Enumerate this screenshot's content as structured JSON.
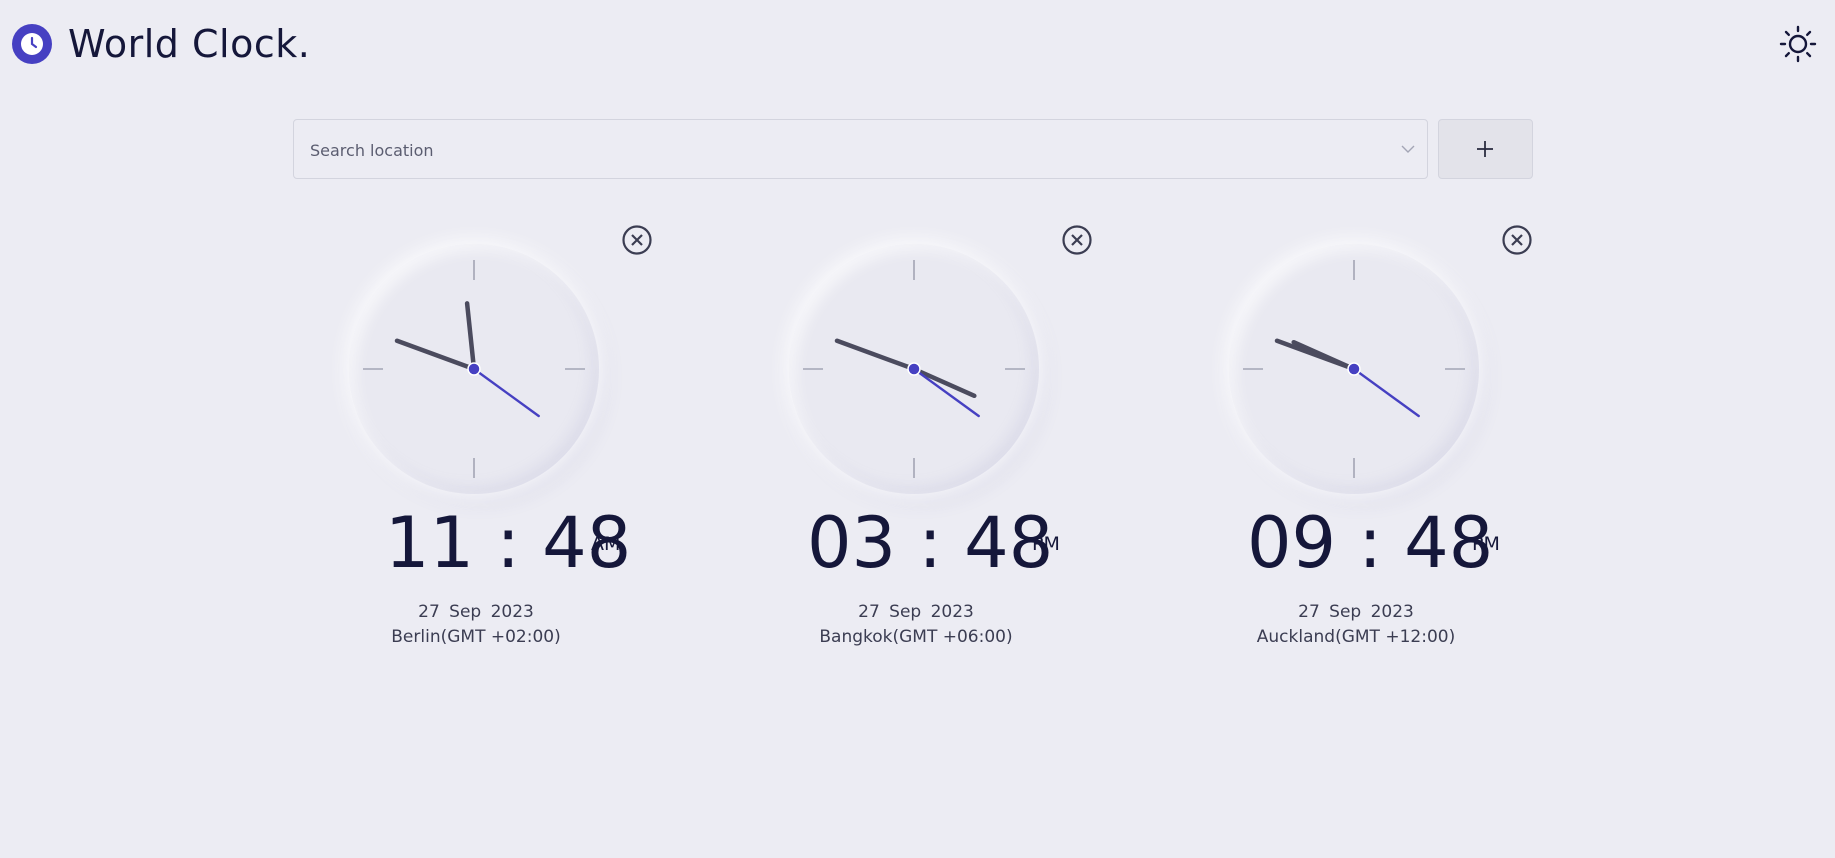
{
  "app": {
    "title": "World Clock.",
    "logo_icon": "clock-icon",
    "theme_icon": "sun-icon"
  },
  "colors": {
    "background": "#ececf3",
    "accent": "#4640c2",
    "text": "#15173a",
    "hand": "#4b4b5e"
  },
  "search": {
    "placeholder": "Search location",
    "value": "",
    "dropdown_icon": "chevron-down-icon",
    "add_icon": "plus-icon"
  },
  "clocks": [
    {
      "time": "11 : 48",
      "ampm": "AM",
      "date": "27 Sep 2023",
      "zone": "Berlin(GMT +02:00)",
      "hours": 11,
      "minutes": 48,
      "seconds": 21
    },
    {
      "time": "03 : 48",
      "ampm": "PM",
      "date": "27 Sep 2023",
      "zone": "Bangkok(GMT +06:00)",
      "hours": 15,
      "minutes": 48,
      "seconds": 21
    },
    {
      "time": "09 : 48",
      "ampm": "PM",
      "date": "27 Sep 2023",
      "zone": "Auckland(GMT +12:00)",
      "hours": 21,
      "minutes": 48,
      "seconds": 21
    }
  ]
}
